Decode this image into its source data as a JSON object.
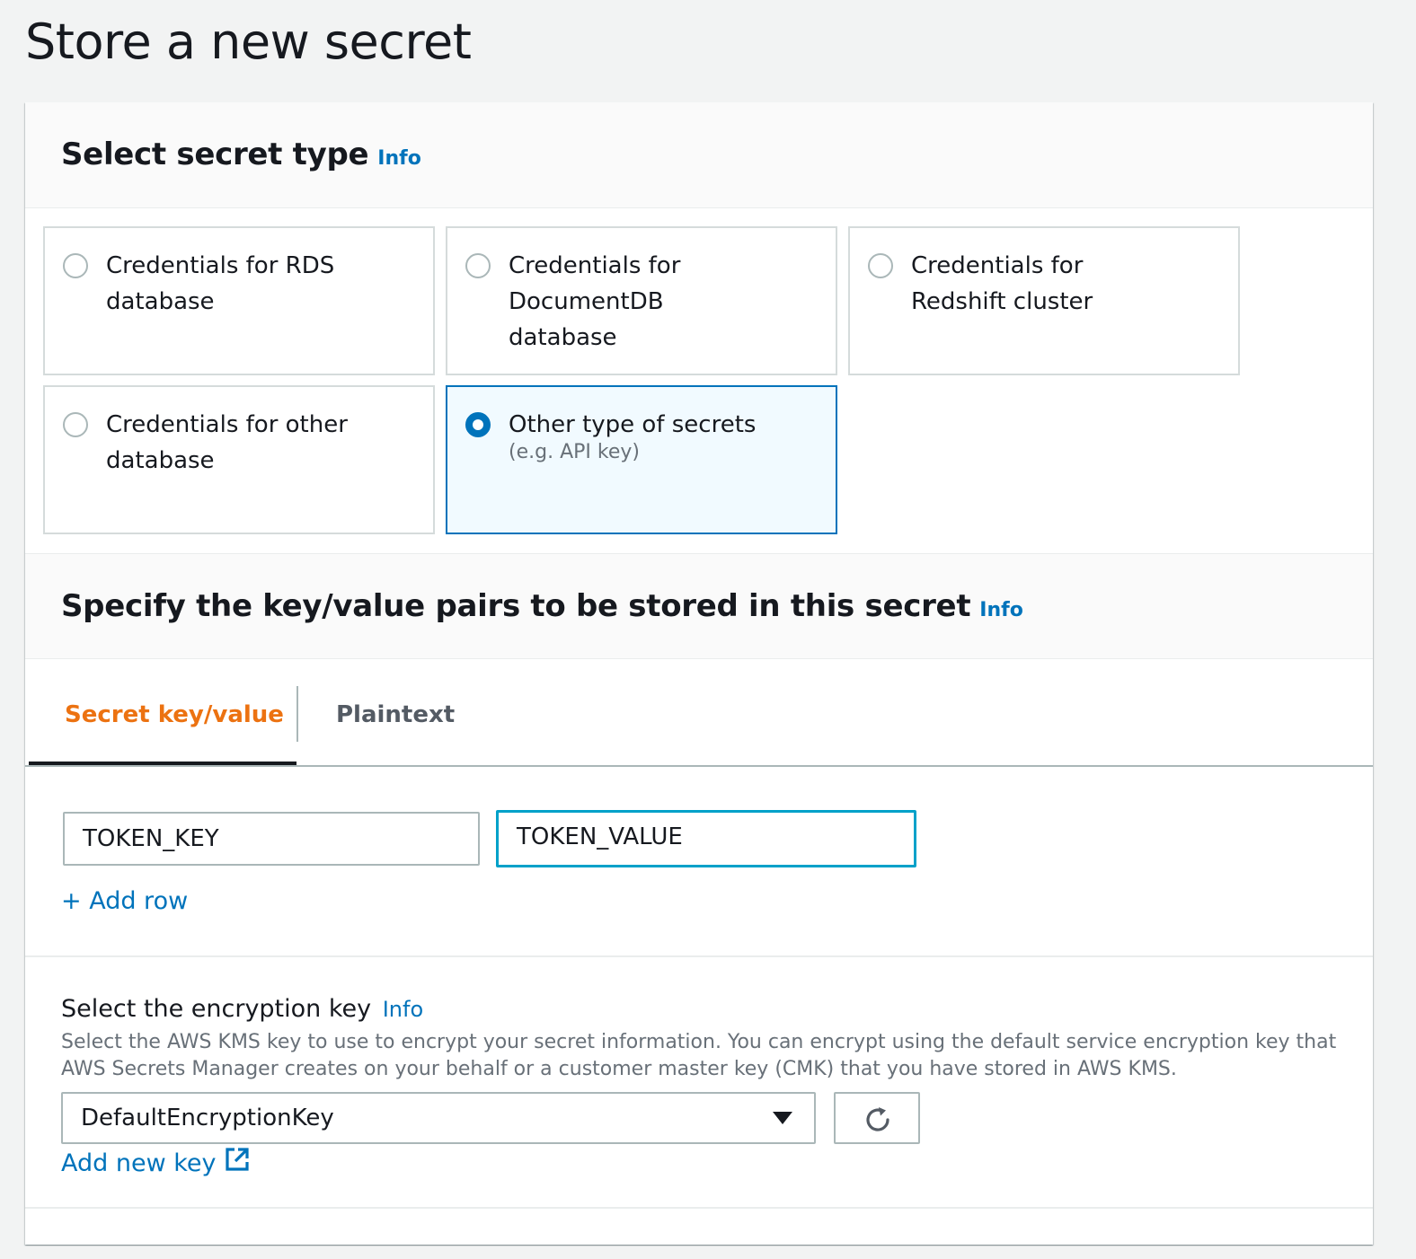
{
  "page": {
    "title": "Store a new secret"
  },
  "secret_type": {
    "heading": "Select secret type",
    "info": "Info",
    "options": [
      {
        "label": "Credentials for RDS database",
        "selected": false
      },
      {
        "label": "Credentials for DocumentDB database",
        "selected": false
      },
      {
        "label": "Credentials for Redshift cluster",
        "selected": false
      },
      {
        "label": "Credentials for other database",
        "selected": false
      },
      {
        "label": "Other type of secrets",
        "sublabel": "(e.g. API key)",
        "selected": true
      }
    ]
  },
  "key_value": {
    "heading": "Specify the key/value pairs to be stored in this secret",
    "info": "Info",
    "tabs": [
      {
        "label": "Secret key/value",
        "active": true
      },
      {
        "label": "Plaintext",
        "active": false
      }
    ],
    "rows": [
      {
        "key": "TOKEN_KEY",
        "value": "TOKEN_VALUE"
      }
    ],
    "add_row": "+ Add row"
  },
  "encryption": {
    "label": "Select the encryption key",
    "info": "Info",
    "description": "Select the AWS KMS key to use to encrypt your secret information. You can encrypt using the default service encryption key that AWS Secrets Manager creates on your behalf or a customer master key (CMK) that you have stored in AWS KMS.",
    "selected_key": "DefaultEncryptionKey",
    "add_new_key": "Add new key"
  },
  "colors": {
    "accent_blue": "#0073bb",
    "active_tab_orange": "#ec7211",
    "focus_cyan": "#00a1c9",
    "selected_tile_bg": "#f1faff"
  },
  "icons": [
    "radio-icon",
    "caret-down-icon",
    "refresh-icon",
    "external-link-icon"
  ]
}
